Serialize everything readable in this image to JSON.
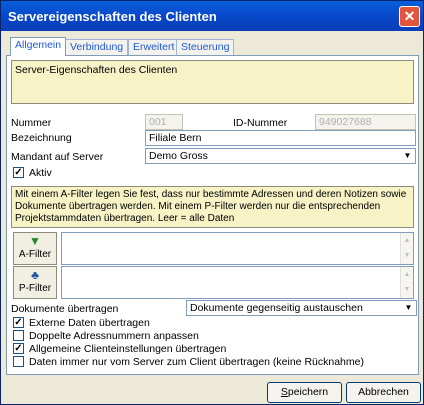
{
  "window": {
    "title": "Servereigenschaften des Clienten",
    "close_symbol": "✕"
  },
  "tabs": [
    {
      "label": "Allgemein",
      "active": true
    },
    {
      "label": "Verbindung",
      "active": false
    },
    {
      "label": "Erweitert",
      "active": false
    },
    {
      "label": "Steuerung",
      "active": false
    }
  ],
  "description": "Server-Eigenschaften des Clienten",
  "fields": {
    "nummer_label": "Nummer",
    "nummer_value": "001",
    "id_label": "ID-Nummer",
    "id_value": "949027688",
    "bezeichnung_label": "Bezeichnung",
    "bezeichnung_value": "Filiale Bern",
    "mandant_label": "Mandant auf Server",
    "mandant_value": "Demo Gross",
    "aktiv_label": "Aktiv",
    "aktiv_checked": true
  },
  "filter_note": "Mit einem A-Filter legen Sie fest, dass nur bestimmte Adressen und deren Notizen sowie Dokumente übertragen werden. Mit einem P-Filter werden nur die entsprechenden Projektstammdaten übertragen. Leer = alle Daten",
  "filters": {
    "a_label": "A-Filter",
    "p_label": "P-Filter",
    "a_icon": "funnel-icon",
    "p_icon": "hierarchy-icon"
  },
  "documents": {
    "label": "Dokumente übertragen",
    "value": "Dokumente gegenseitig austauschen"
  },
  "options": [
    {
      "label": "Externe Daten übertragen",
      "checked": true
    },
    {
      "label": "Doppelte Adressnummern anpassen",
      "checked": false
    },
    {
      "label": "Allgemeine Clienteinstellungen übertragen",
      "checked": true
    },
    {
      "label": "Daten immer nur vom Server zum Client übertragen (keine Rücknahme)",
      "checked": false
    }
  ],
  "buttons": {
    "save_prefix": "",
    "save_mnemonic": "S",
    "save_rest": "peichern",
    "cancel": "Abbrechen"
  },
  "colors": {
    "title_bar": "#0846c8",
    "note_bg": "#f7f3c6",
    "dialog_bg": "#ece9d8"
  }
}
